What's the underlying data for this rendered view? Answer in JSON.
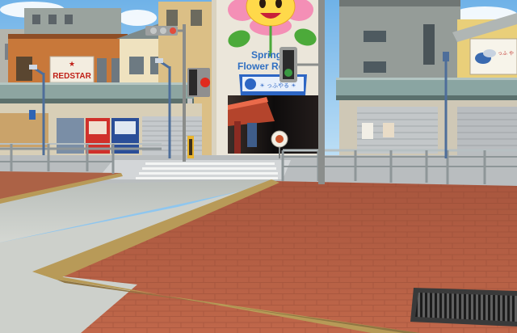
{
  "scene": {
    "type": "game-street-view",
    "signs": {
      "redstar": "REDSTAR",
      "arcade_line1": "Spring",
      "arcade_line2": "Flower Road",
      "banner_text": "☀ っふやる ☀",
      "right_shop": "っふ や"
    },
    "palette": {
      "sky": "#8fc6ee",
      "brick": "#b45a3e",
      "sidewalk": "#c9ccc8",
      "road": "#b4b8ba",
      "curb": "#b89a58",
      "arcade_wall": "#e9e3d5",
      "grate": "#2a2a2a"
    }
  }
}
